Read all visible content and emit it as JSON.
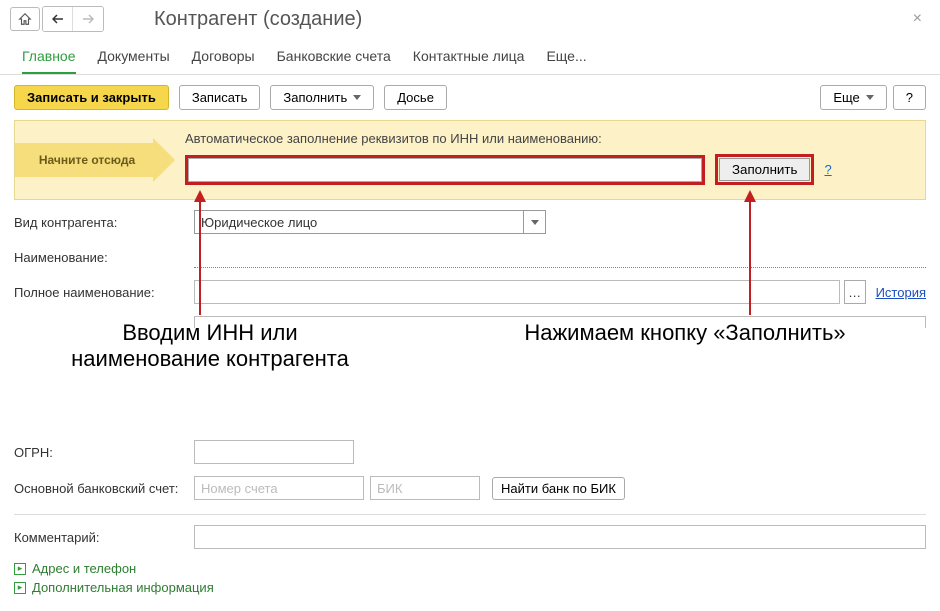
{
  "header": {
    "title": "Контрагент (создание)"
  },
  "tabs": {
    "main": "Главное",
    "documents": "Документы",
    "contracts": "Договоры",
    "bank_accounts": "Банковские счета",
    "contacts": "Контактные лица",
    "more": "Еще..."
  },
  "toolbar": {
    "save_close": "Записать и закрыть",
    "save": "Записать",
    "fill": "Заполнить",
    "dossier": "Досье",
    "more": "Еще",
    "help": "?"
  },
  "hint": {
    "start_here": "Начните отсюда",
    "label": "Автоматическое заполнение реквизитов по ИНН или наименованию:",
    "fill_btn": "Заполнить",
    "help": "?"
  },
  "form": {
    "type_label": "Вид контрагента:",
    "type_value": "Юридическое лицо",
    "name_label": "Наименование:",
    "full_name_label": "Полное наименование:",
    "history_link": "История",
    "ogrn_label": "ОГРН:",
    "bank_label": "Основной банковский счет:",
    "account_placeholder": "Номер счета",
    "bik_placeholder": "БИК",
    "find_bank": "Найти банк по БИК",
    "comment_label": "Комментарий:",
    "expand_address": "Адрес и телефон",
    "expand_extra": "Дополнительная информация"
  },
  "annotations": {
    "left": "Вводим ИНН или наименование контрагента",
    "right": "Нажимаем кнопку «Заполнить»"
  }
}
